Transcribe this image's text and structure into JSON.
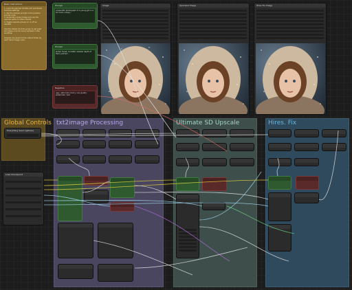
{
  "canvas": {
    "background": "#1c1c1c"
  },
  "notes": {
    "title": "Basic Instructions",
    "body": "1. Load all required models and set Global Controls settings\n2. Set the desired prompt in the positive prompt node\n3. Generate a base image and use the upscale paths to refine results\n4. Toggle upscale groups on or off as needed\n\nUse the Global Controls group to set seed and steps once for every sampler in the workflow.\n\nOutputs are saved to the output folder by each Save Image node."
  },
  "prompt_nodes": [
    {
      "title": "Prompt",
      "text": "a beautiful photograph of a young girl in a fur hood, snowy..."
    },
    {
      "title": "Prompt",
      "text": "winter forest, snowfall, shallow depth of field, portrait..."
    },
    {
      "title": "Negative",
      "text": "ugly, deformed, blurry, low quality, watermark, text"
    }
  ],
  "preview_nodes": [
    {
      "title": "Image"
    },
    {
      "title": "Upscaled Image"
    },
    {
      "title": "Hires Fix Image"
    }
  ],
  "groups": {
    "global": {
      "title": "Global Controls",
      "color": "#d7a136"
    },
    "txt2img": {
      "title": "txt2image Processing",
      "color": "#a08cd8"
    },
    "usd": {
      "title": "Ultimate SD Upscale",
      "color": "#90c4b0"
    },
    "hires": {
      "title": "Hires. Fix",
      "color": "#5aa7d0"
    }
  },
  "global_node": {
    "title": "Everything Seed (rgthree)",
    "value": "Seed: 42"
  },
  "loader_node": {
    "title": "Load Checkpoint"
  },
  "link_colors": [
    "#e6d23a",
    "#e0e0e0",
    "#a0d8f0",
    "#d46a6a",
    "#b06ad4",
    "#6ad48a"
  ]
}
